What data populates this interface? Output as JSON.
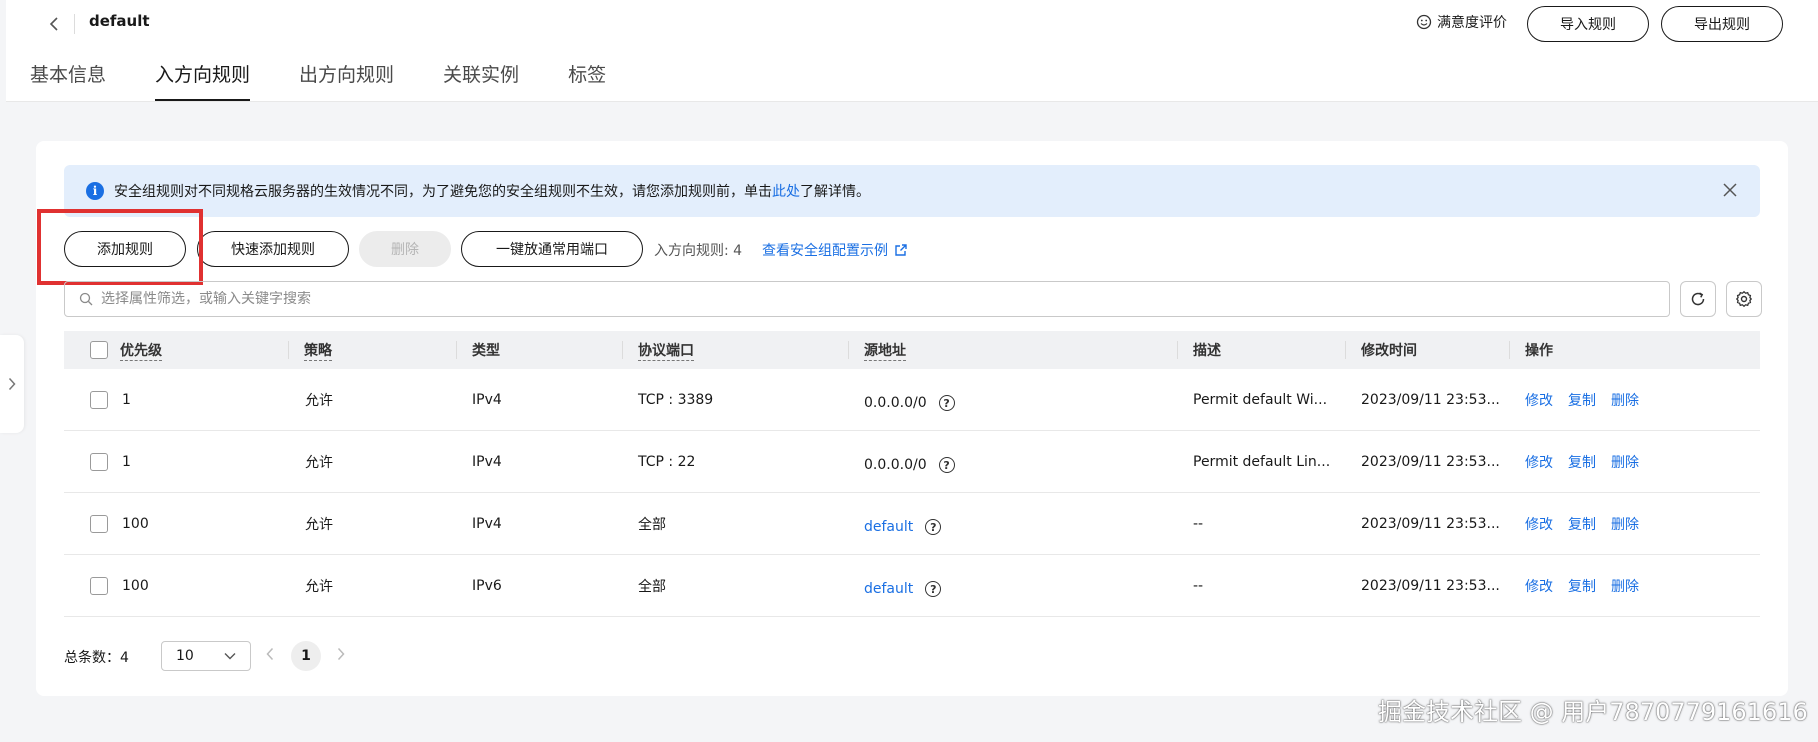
{
  "header": {
    "title": "default",
    "rate_label": "满意度评价",
    "import_label": "导入规则",
    "export_label": "导出规则"
  },
  "tabs": [
    {
      "label": "基本信息",
      "active": false
    },
    {
      "label": "入方向规则",
      "active": true
    },
    {
      "label": "出方向规则",
      "active": false
    },
    {
      "label": "关联实例",
      "active": false
    },
    {
      "label": "标签",
      "active": false
    }
  ],
  "alert": {
    "text_before": "安全组规则对不同规格云服务器的生效情况不同，为了避免您的安全组规则不生效，请您添加规则前，单击",
    "link": "此处",
    "text_after": "了解详情。"
  },
  "toolbar": {
    "add_label": "添加规则",
    "quick_add_label": "快速添加规则",
    "delete_label": "删除",
    "open_ports_label": "一键放通常用端口",
    "rule_count_text": "入方向规则: 4",
    "example_link": "查看安全组配置示例"
  },
  "search": {
    "placeholder": "选择属性筛选，或输入关键字搜索"
  },
  "table": {
    "headers": {
      "priority": "优先级",
      "policy": "策略",
      "type": "类型",
      "port": "协议端口",
      "source": "源地址",
      "desc": "描述",
      "modified": "修改时间",
      "ops": "操作"
    },
    "rows": [
      {
        "priority": "1",
        "policy": "允许",
        "type": "IPv4",
        "port": "TCP : 3389",
        "source": "0.0.0.0/0",
        "source_is_link": false,
        "desc": "Permit default Wi...",
        "modified": "2023/09/11 23:53...",
        "op_edit": "修改",
        "op_copy": "复制",
        "op_delete": "删除"
      },
      {
        "priority": "1",
        "policy": "允许",
        "type": "IPv4",
        "port": "TCP : 22",
        "source": "0.0.0.0/0",
        "source_is_link": false,
        "desc": "Permit default Lin...",
        "modified": "2023/09/11 23:53...",
        "op_edit": "修改",
        "op_copy": "复制",
        "op_delete": "删除"
      },
      {
        "priority": "100",
        "policy": "允许",
        "type": "IPv4",
        "port": "全部",
        "source": "default",
        "source_is_link": true,
        "desc": "--",
        "modified": "2023/09/11 23:53...",
        "op_edit": "修改",
        "op_copy": "复制",
        "op_delete": "删除"
      },
      {
        "priority": "100",
        "policy": "允许",
        "type": "IPv6",
        "port": "全部",
        "source": "default",
        "source_is_link": true,
        "desc": "--",
        "modified": "2023/09/11 23:53...",
        "op_edit": "修改",
        "op_copy": "复制",
        "op_delete": "删除"
      }
    ]
  },
  "pagination": {
    "total_text": "总条数：4",
    "page_size": "10",
    "current_page": "1"
  },
  "watermark": "掘金技术社区 @ 用户7870779161616",
  "colors": {
    "accent": "#1a6fe3",
    "alert_bg": "#e3eefc",
    "highlight": "#e03131"
  }
}
